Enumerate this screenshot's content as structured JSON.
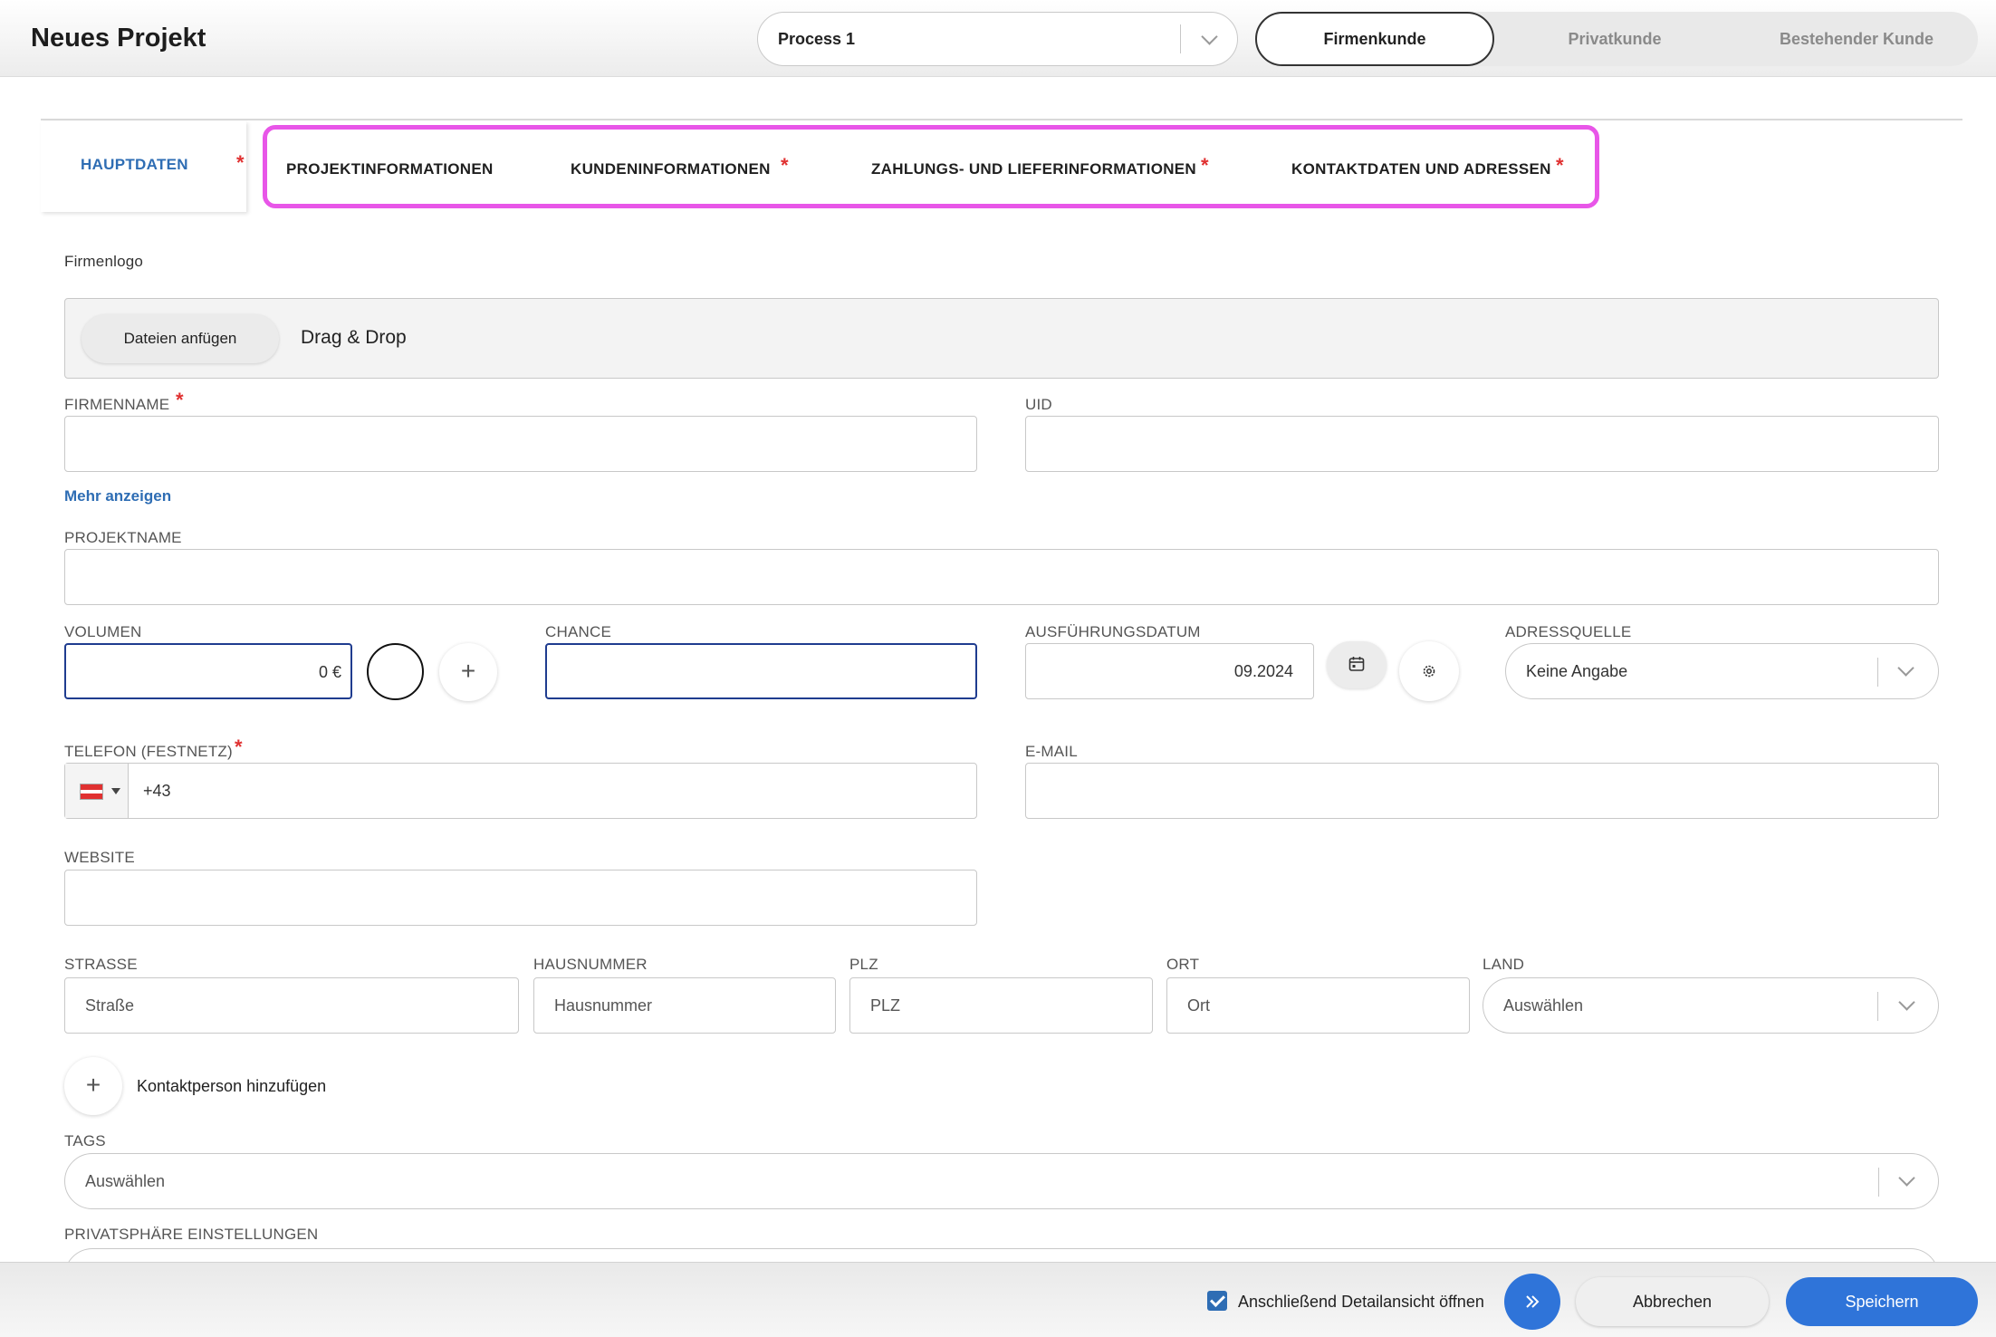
{
  "header": {
    "title": "Neues Projekt",
    "process_value": "Process 1",
    "segments": [
      "Firmenkunde",
      "Privatkunde",
      "Bestehender Kunde"
    ]
  },
  "tabs": {
    "main": "HAUPTDATEN",
    "items": [
      "PROJEKTINFORMATIONEN",
      "KUNDENINFORMATIONEN",
      "ZAHLUNGS- UND LIEFERINFORMATIONEN",
      "KONTAKTDATEN UND ADRESSEN"
    ],
    "required_mark": "*"
  },
  "form": {
    "logo_label": "Firmenlogo",
    "upload_button": "Dateien anfügen",
    "upload_hint": "Drag & Drop",
    "firmenname_label": "FIRMENNAME",
    "uid_label": "UID",
    "mehr_anzeigen": "Mehr anzeigen",
    "projektname_label": "PROJEKTNAME",
    "volumen_label": "VOLUMEN",
    "volumen_value": "0 €",
    "chance_label": "CHANCE",
    "ausfuehrungsdatum_label": "AUSFÜHRUNGSDATUM",
    "ausfuehrungsdatum_value": "09.2024",
    "adressquelle_label": "ADRESSQUELLE",
    "adressquelle_value": "Keine Angabe",
    "telefon_label": "TELEFON (FESTNETZ)",
    "telefon_value": "+43",
    "email_label": "E-MAIL",
    "website_label": "WEBSITE",
    "strasse_label": "STRASSE",
    "strasse_placeholder": "Straße",
    "hausnummer_label": "HAUSNUMMER",
    "hausnummer_placeholder": "Hausnummer",
    "plz_label": "PLZ",
    "plz_placeholder": "PLZ",
    "ort_label": "ORT",
    "ort_placeholder": "Ort",
    "land_label": "LAND",
    "land_placeholder": "Auswählen",
    "add_contact": "Kontaktperson hinzufügen",
    "tags_label": "TAGS",
    "tags_placeholder": "Auswählen",
    "privacy_label": "PRIVATSPHÄRE EINSTELLUNGEN"
  },
  "footer": {
    "checkbox_label": "Anschließend Detailansicht öffnen",
    "cancel": "Abbrechen",
    "save": "Speichern"
  },
  "colors": {
    "accent": "#2f74d9",
    "link": "#2e6db4",
    "required": "#e03131",
    "highlight": "#e856e8"
  }
}
